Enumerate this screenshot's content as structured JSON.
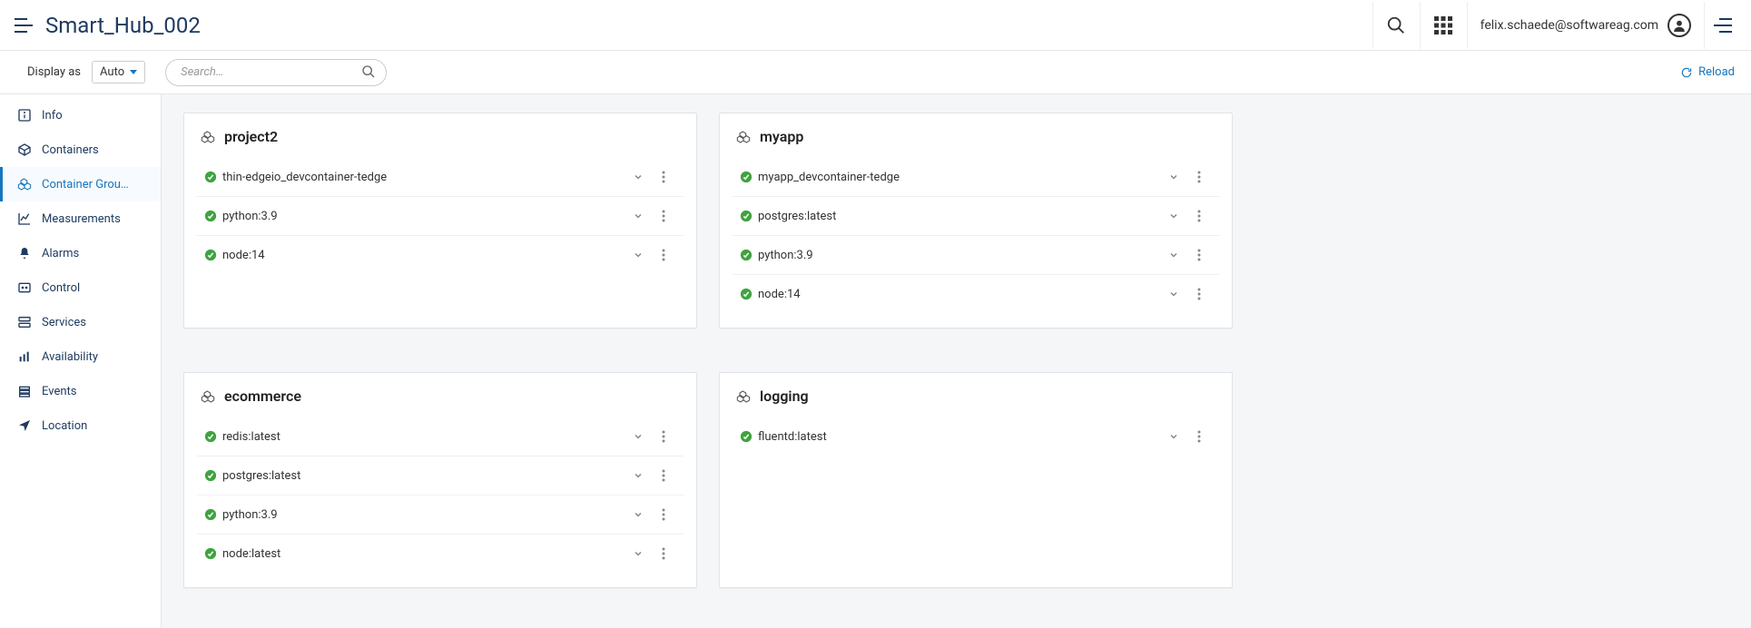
{
  "header": {
    "title": "Smart_Hub_002",
    "user_email": "felix.schaede@softwareag.com"
  },
  "toolbar": {
    "display_label": "Display as",
    "display_value": "Auto",
    "search_placeholder": "Search…",
    "reload_label": "Reload"
  },
  "sidebar": {
    "items": [
      {
        "label": "Info",
        "icon": "info"
      },
      {
        "label": "Containers",
        "icon": "container"
      },
      {
        "label": "Container Grou…",
        "icon": "group",
        "active": true
      },
      {
        "label": "Measurements",
        "icon": "chart"
      },
      {
        "label": "Alarms",
        "icon": "bell"
      },
      {
        "label": "Control",
        "icon": "control"
      },
      {
        "label": "Services",
        "icon": "services"
      },
      {
        "label": "Availability",
        "icon": "bars"
      },
      {
        "label": "Events",
        "icon": "events"
      },
      {
        "label": "Location",
        "icon": "location"
      }
    ]
  },
  "groups": [
    {
      "name": "project2",
      "containers": [
        {
          "name": "thin-edgeio_devcontainer-tedge",
          "status": "ok"
        },
        {
          "name": "python:3.9",
          "status": "ok"
        },
        {
          "name": "node:14",
          "status": "ok"
        }
      ]
    },
    {
      "name": "myapp",
      "containers": [
        {
          "name": "myapp_devcontainer-tedge",
          "status": "ok"
        },
        {
          "name": "postgres:latest",
          "status": "ok"
        },
        {
          "name": "python:3.9",
          "status": "ok"
        },
        {
          "name": "node:14",
          "status": "ok"
        }
      ]
    },
    {
      "name": "ecommerce",
      "containers": [
        {
          "name": "redis:latest",
          "status": "ok"
        },
        {
          "name": "postgres:latest",
          "status": "ok"
        },
        {
          "name": "python:3.9",
          "status": "ok"
        },
        {
          "name": "node:latest",
          "status": "ok"
        }
      ]
    },
    {
      "name": "logging",
      "containers": [
        {
          "name": "fluentd:latest",
          "status": "ok"
        }
      ]
    }
  ],
  "colors": {
    "accent": "#1776bf",
    "navy": "#1f3a5f",
    "ok_green": "#3fa33f"
  }
}
